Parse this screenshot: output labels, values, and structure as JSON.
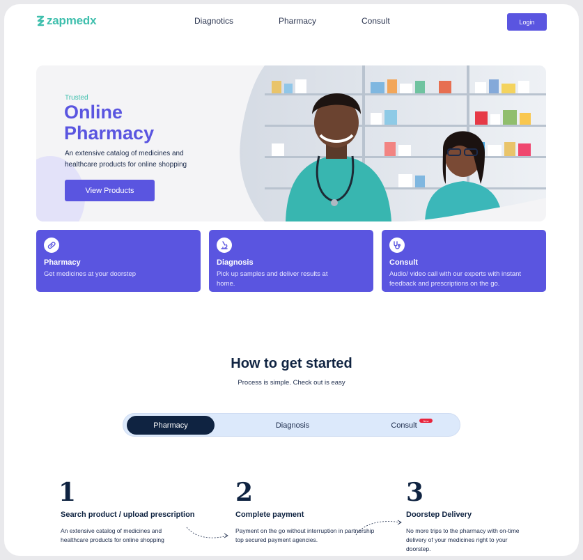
{
  "brand": {
    "name": "zapmedx",
    "color": "#3fbfad",
    "accent": "#5a55e0"
  },
  "nav": {
    "items": [
      "Diagnotics",
      "Pharmacy",
      "Consult"
    ],
    "login_label": "Login"
  },
  "hero": {
    "eyebrow": "Trusted",
    "title": "Online Pharmacy",
    "description": "An extensive catalog of medicines and healthcare products for online shopping",
    "cta_label": "View Products"
  },
  "services": [
    {
      "title": "Pharmacy",
      "description": "Get medicines at your doorstep",
      "icon": "pills-icon"
    },
    {
      "title": "Diagnosis",
      "description": "Pick up samples and deliver results at home.",
      "icon": "microscope-icon"
    },
    {
      "title": "Consult",
      "description": "Audio/ video call with our experts with instant feedback and prescriptions on the go.",
      "icon": "stethoscope-icon"
    }
  ],
  "how": {
    "title": "How to get started",
    "subtitle": "Process is simple. Check out is easy",
    "tabs": [
      "Pharmacy",
      "Diagnosis",
      "Consult"
    ],
    "active_tab": "Pharmacy",
    "badge": "New"
  },
  "steps": [
    {
      "number": "1",
      "title": "Search product / upload prescription",
      "description": "An extensive catalog of medicines and healthcare products for online shopping"
    },
    {
      "number": "2",
      "title": "Complete payment",
      "description": "Payment on the go without interruption in partnership top secured payment agencies."
    },
    {
      "number": "3",
      "title": "Doorstep Delivery",
      "description": "No more trips to the pharmacy with on-time delivery of your medicines right to your doorstep."
    }
  ]
}
